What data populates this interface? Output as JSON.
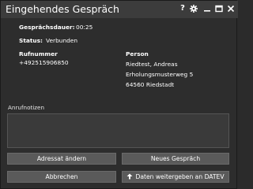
{
  "window": {
    "title": "Eingehendes Gespräch",
    "controls": [
      "help-icon",
      "settings-icon",
      "minimize-icon",
      "maximize-icon",
      "close-icon"
    ],
    "help_glyph": "?"
  },
  "call": {
    "duration_label": "Gesprächsdauer:",
    "duration_value": "00:25",
    "status_label": "Status:",
    "status_value": "Verbunden",
    "number_label": "Rufnummer",
    "number_value": "+492515906850",
    "person_label": "Person",
    "person_name": "Riedtest, Andreas",
    "person_street": "Erholungsmusterweg 5",
    "person_city": "64560  Riedstadt"
  },
  "notes": {
    "label": "Anrufnotizen",
    "value": ""
  },
  "buttons": {
    "change_addressee": "Adressat ändern",
    "new_call": "Neues Gespräch",
    "cancel": "Abbrechen",
    "pass_to_datev": "Daten weitergeben an DATEV"
  },
  "colors": {
    "background": "#2d2d2d",
    "titlebar": "#3c3c3c",
    "button": "#5a5a5a",
    "notes_field": "#3a3a3a"
  }
}
